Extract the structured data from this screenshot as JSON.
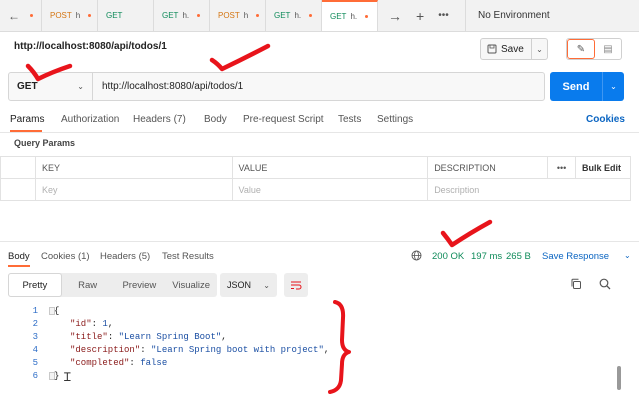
{
  "tabs": [
    {
      "method": "",
      "name": ""
    },
    {
      "method": "POST",
      "name": "h"
    },
    {
      "method": "GET",
      "name": ""
    },
    {
      "method": "GET",
      "name": "h."
    },
    {
      "method": "POST",
      "name": "h"
    },
    {
      "method": "GET",
      "name": "h."
    },
    {
      "method": "GET",
      "name": "h."
    }
  ],
  "environment": "No Environment",
  "request": {
    "title": "http://localhost:8080/api/todos/1",
    "method": "GET",
    "url": "http://localhost:8080/api/todos/1",
    "save_label": "Save",
    "send_label": "Send"
  },
  "request_tabs": {
    "params": "Params",
    "authorization": "Authorization",
    "headers": "Headers",
    "headers_count": "(7)",
    "body": "Body",
    "prerequest": "Pre-request Script",
    "tests": "Tests",
    "settings": "Settings",
    "cookies": "Cookies"
  },
  "query_params": {
    "title": "Query Params",
    "columns": [
      "KEY",
      "VALUE",
      "DESCRIPTION"
    ],
    "more": "•••",
    "bulk_edit": "Bulk Edit",
    "placeholders": [
      "Key",
      "Value",
      "Description"
    ]
  },
  "response_tabs": {
    "body": "Body",
    "cookies": "Cookies",
    "cookies_count": "(1)",
    "headers": "Headers",
    "headers_count": "(5)",
    "test_results": "Test Results",
    "status": "200 OK",
    "time": "197 ms",
    "size": "265 B",
    "save_response": "Save Response"
  },
  "response_view": {
    "modes": [
      "Pretty",
      "Raw",
      "Preview",
      "Visualize"
    ],
    "active_mode": "Pretty",
    "format": "JSON"
  },
  "response_body": {
    "line_numbers": [
      "1",
      "2",
      "3",
      "4",
      "5",
      "6"
    ],
    "open_brace": "{",
    "close_brace": "}",
    "fields": [
      {
        "key": "\"id\"",
        "value": "1",
        "comma": ","
      },
      {
        "key": "\"title\"",
        "value": "\"Learn Spring Boot\"",
        "comma": ","
      },
      {
        "key": "\"description\"",
        "value": "\"Learn Spring boot with project\"",
        "comma": ","
      },
      {
        "key": "\"completed\"",
        "value": "false",
        "comma": ""
      }
    ]
  },
  "colors": {
    "accent": "#ff6c37",
    "send": "#097bed",
    "success": "#0f8b5a",
    "link": "#0b65c2",
    "annotation": "#e8141b"
  }
}
